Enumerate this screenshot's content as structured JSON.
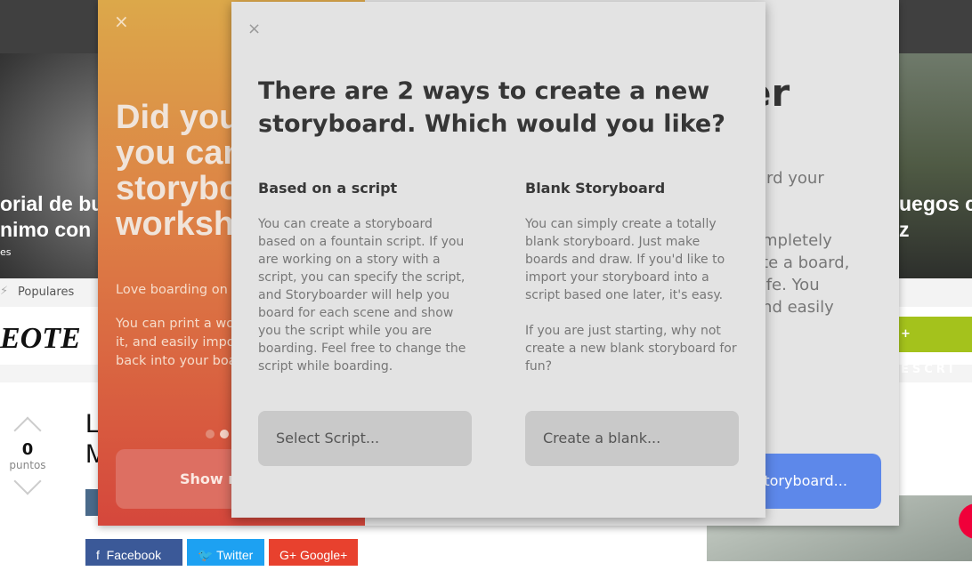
{
  "background_page": {
    "headline_left": [
      "orial de bu",
      "nimo con"
    ],
    "headline_left_sub": "es",
    "headline_right": [
      "uegos c",
      "z"
    ],
    "popular_label": "Populares",
    "logo_text": "EOTE",
    "write_button": "ESCRI",
    "votes": {
      "count": "0",
      "label": "puntos"
    },
    "article_title": [
      "L",
      "M"
    ],
    "share": {
      "facebook": "Facebook",
      "twitter": "Twitter",
      "google": "Google+"
    }
  },
  "welcome_window": {
    "close_icon": "×",
    "headline": "Did you\nyou can\nstorybo\nworksh",
    "paragraph_1": "Love boarding on p",
    "paragraph_2": "You can print a wor\nit, and easily impor\nback into your boa",
    "carousel": {
      "total": 2,
      "active": 1
    },
    "show_more_button": "Show m",
    "title_fragment": "er",
    "right_text_1": "ard your",
    "right_text_2": "ompletely\nate a board,\n life. You\nand easily",
    "new_storyboard_button": "w Storyboard..."
  },
  "modal": {
    "close_icon": "×",
    "title": "There are 2 ways to create a new storyboard. Which would you like?",
    "options": [
      {
        "heading": "Based on a script",
        "body": "You can create a storyboard based on a fountain script. If you are working on a story with a script, you can specify the script, and Storyboarder will help you board for each scene and show you the script while you are boarding. Feel free to change the script while boarding.",
        "button": "Select Script..."
      },
      {
        "heading": "Blank Storyboard",
        "body": "You can simply create a totally blank storyboard. Just make boards and draw. If you'd like to import your storyboard into a script based one later, it's easy.",
        "body_2": "If you are just starting, why not create a new blank storyboard for fun?",
        "button": "Create a blank..."
      }
    ]
  },
  "colors": {
    "accent_blue": "#5d88ea",
    "orange_top": "#dca84a",
    "orange_bottom": "#d5473c",
    "write_green": "#a4c21c"
  }
}
